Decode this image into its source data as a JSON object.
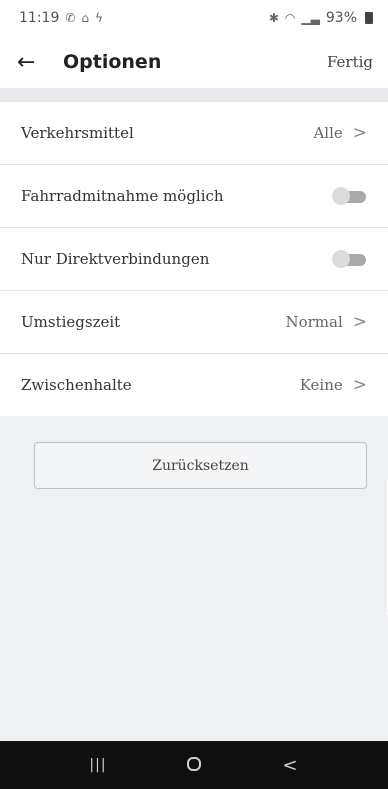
{
  "status_bar": {
    "time": "11:19",
    "left_icons": [
      "call-icon",
      "home-icon",
      "flash-icon"
    ],
    "right_icons": [
      "bluetooth-icon",
      "wifi-icon",
      "signal-icon"
    ],
    "battery": "93%"
  },
  "app_bar": {
    "title": "Optionen",
    "done_label": "Fertig"
  },
  "options": [
    {
      "label": "Verkehrsmittel",
      "value": "Alle",
      "type": "link"
    },
    {
      "label": "Fahrradmitnahme möglich",
      "type": "toggle",
      "enabled": false
    },
    {
      "label": "Nur Direktverbindungen",
      "type": "toggle",
      "enabled": false
    },
    {
      "label": "Umstiegszeit",
      "value": "Normal",
      "type": "link"
    },
    {
      "label": "Zwischenhalte",
      "value": "Keine",
      "type": "link"
    }
  ],
  "reset_label": "Zurücksetzen",
  "nav": {
    "recents_glyph": "|||",
    "back_glyph": "<"
  }
}
